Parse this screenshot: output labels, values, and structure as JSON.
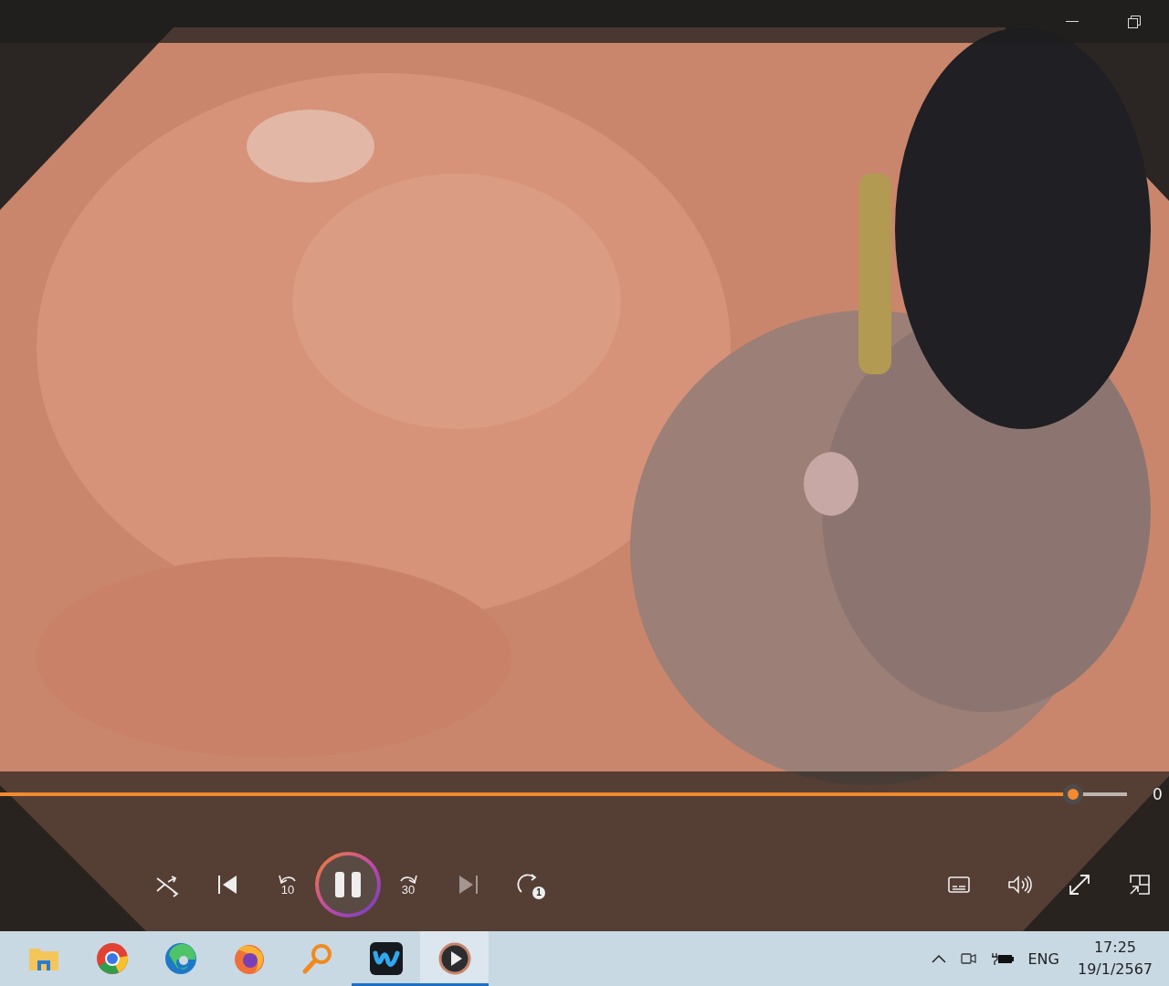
{
  "seek_bar": {
    "level": 0.952,
    "time": "0"
  },
  "controls": {
    "playing": true,
    "skip_back": "10",
    "skip_forward": "30",
    "next_disabled": true,
    "repeat_badge": "1"
  },
  "taskbar": {
    "apps": [
      {
        "kind": "folder",
        "running": false,
        "selected": false
      },
      {
        "kind": "ring",
        "running": false,
        "selected": false
      },
      {
        "kind": "swirl",
        "running": false,
        "selected": false
      },
      {
        "kind": "flame",
        "running": false,
        "selected": false
      },
      {
        "kind": "magnifier",
        "running": false,
        "selected": false
      },
      {
        "kind": "wave",
        "running": true,
        "selected": false
      },
      {
        "kind": "player",
        "running": true,
        "selected": true
      }
    ],
    "language": "ENG",
    "time": "17:25",
    "date": "19/1/2567"
  }
}
